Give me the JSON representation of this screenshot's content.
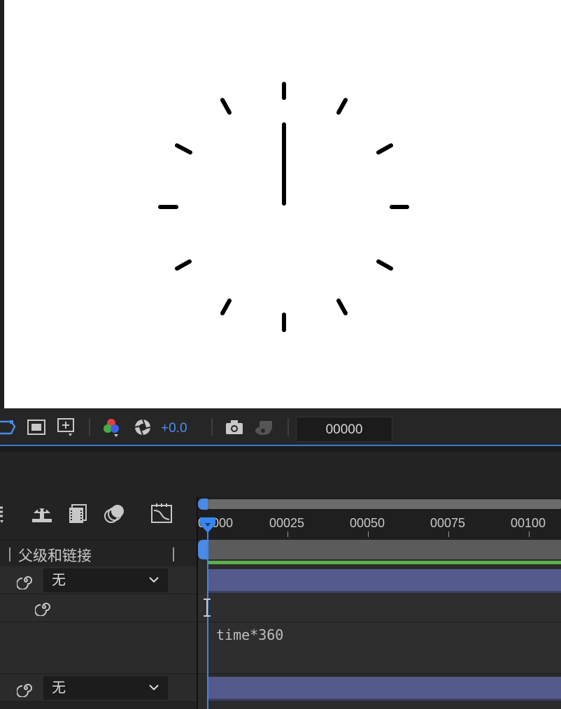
{
  "toolbar": {
    "exposure_value": "+0.0",
    "current_frame": "00000"
  },
  "timeline": {
    "ruler_ticks": [
      "00000",
      "00025",
      "00050",
      "00075",
      "00100"
    ],
    "column_header": {
      "parent_label": "父级和链接"
    },
    "layers": [
      {
        "parent_value": "无"
      },
      {
        "parent_value": "无"
      }
    ],
    "expression": "time*360"
  },
  "colors": {
    "accent": "#3a86f0",
    "layer_bar": "#545b8c",
    "work_area_green": "#5cb04a"
  }
}
